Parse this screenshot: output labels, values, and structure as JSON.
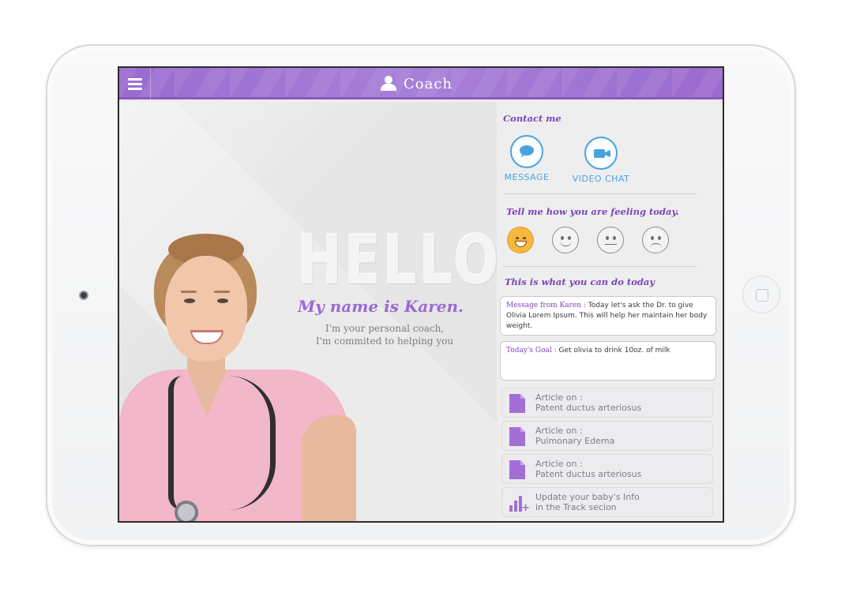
{
  "header": {
    "title": "Coach",
    "menu_icon": "hamburger-icon",
    "title_icon": "person-icon"
  },
  "intro": {
    "hello": "HELLO",
    "name_line": "My name is Karen.",
    "tagline_line1": "I'm your personal coach,",
    "tagline_line2": "I'm commited to helping you"
  },
  "contact": {
    "title": "Contact me",
    "message_label": "MESSAGE",
    "video_label": "VIDEO CHAT",
    "message_icon": "chat-bubble-icon",
    "video_icon": "video-camera-icon"
  },
  "feeling": {
    "title": "Tell me how you are feeling today.",
    "moods": [
      "very-happy-face-icon",
      "happy-face-icon",
      "neutral-face-icon",
      "sad-face-icon"
    ],
    "selected_mood": 0
  },
  "today": {
    "title": "This is what you can do today",
    "message_label": "Message from Karen :",
    "message_text": "Today let's ask the Dr. to give Olivia Lorem Ipsum. This will help her maintain her body weight.",
    "goal_label": "Today's Goal :",
    "goal_text": "Get olivia to drink 10oz. of milk",
    "articles": [
      {
        "line1": "Article on :",
        "line2": "Patent ductus arteriosus",
        "icon": "document-icon"
      },
      {
        "line1": "Article on :",
        "line2": "Pulmonary Edema",
        "icon": "document-icon"
      },
      {
        "line1": "Article on :",
        "line2": "Patent ductus arteriosus",
        "icon": "document-icon"
      },
      {
        "line1": "Update your baby's Info",
        "line2": "in the Track secion",
        "icon": "chart-add-icon"
      }
    ]
  },
  "colors": {
    "brand_purple": "#9b6bd0",
    "accent_blue": "#4aa3df",
    "selected_mood": "#f6b73c"
  }
}
